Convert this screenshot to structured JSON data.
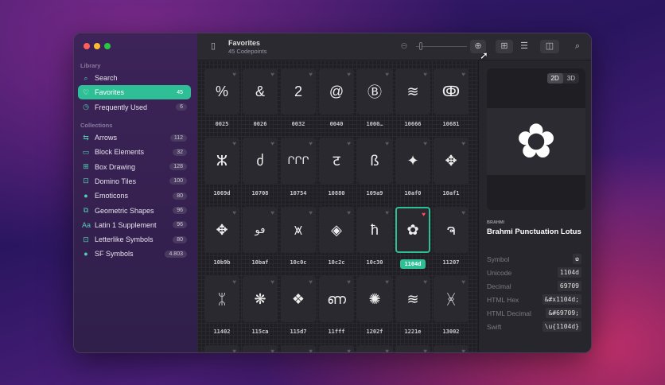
{
  "sidebar": {
    "library_label": "Library",
    "collections_label": "Collections",
    "library": [
      {
        "label": "Search",
        "icon": "search-icon",
        "glyph": "⌕",
        "count": null
      },
      {
        "label": "Favorites",
        "icon": "heart-icon",
        "glyph": "♡",
        "count": "45",
        "active": true
      },
      {
        "label": "Frequently Used",
        "icon": "clock-icon",
        "glyph": "◷",
        "count": "6"
      }
    ],
    "collections": [
      {
        "label": "Arrows",
        "icon": "arrows-icon",
        "glyph": "⇆",
        "count": "112"
      },
      {
        "label": "Block Elements",
        "icon": "block-elements-icon",
        "glyph": "▭",
        "count": "32"
      },
      {
        "label": "Box Drawing",
        "icon": "box-drawing-icon",
        "glyph": "⊞",
        "count": "128"
      },
      {
        "label": "Domino Tiles",
        "icon": "gamepad-icon",
        "glyph": "⊡",
        "count": "100"
      },
      {
        "label": "Emoticons",
        "icon": "emoticon-icon",
        "glyph": "●",
        "count": "80"
      },
      {
        "label": "Geometric Shapes",
        "icon": "shapes-icon",
        "glyph": "⧉",
        "count": "96"
      },
      {
        "label": "Latin 1 Supplement",
        "icon": "text-aa-icon",
        "glyph": "Aa",
        "count": "96"
      },
      {
        "label": "Letterlike Symbols",
        "icon": "letterlike-icon",
        "glyph": "⊡",
        "count": "80"
      },
      {
        "label": "SF Symbols",
        "icon": "apple-icon",
        "glyph": "●",
        "count": "4.803"
      }
    ]
  },
  "toolbar": {
    "title": "Favorites",
    "subtitle": "45 Codepoints"
  },
  "grid": {
    "selected": "1104d",
    "tiles": [
      {
        "glyph": "%",
        "code": "0025"
      },
      {
        "glyph": "&",
        "code": "0026"
      },
      {
        "glyph": "2",
        "code": "0032"
      },
      {
        "glyph": "@",
        "code": "0040"
      },
      {
        "glyph": "Ⓑ",
        "code": "1000…"
      },
      {
        "glyph": "≋",
        "code": "10666"
      },
      {
        "glyph": "ↂ",
        "code": "10681"
      },
      {
        "glyph": "ⵣ",
        "code": "1069d"
      },
      {
        "glyph": "ძ",
        "code": "10708"
      },
      {
        "glyph": "ՐՐՐ",
        "code": "10754"
      },
      {
        "glyph": "ट",
        "code": "10880"
      },
      {
        "glyph": "ß",
        "code": "109a9"
      },
      {
        "glyph": "✦",
        "code": "10af0"
      },
      {
        "glyph": "✥",
        "code": "10af1"
      },
      {
        "glyph": "✥",
        "code": "10b9b"
      },
      {
        "glyph": "ڡو",
        "code": "10baf"
      },
      {
        "glyph": "⩙",
        "code": "10c0c"
      },
      {
        "glyph": "◈",
        "code": "10c2c"
      },
      {
        "glyph": "ħ",
        "code": "10c30"
      },
      {
        "glyph": "✿",
        "code": "1104d"
      },
      {
        "glyph": "ຈ",
        "code": "11207"
      },
      {
        "glyph": "ᛯ",
        "code": "11402"
      },
      {
        "glyph": "❋",
        "code": "115ca"
      },
      {
        "glyph": "❖",
        "code": "115d7"
      },
      {
        "glyph": "ണ",
        "code": "11fff"
      },
      {
        "glyph": "✺",
        "code": "1202f"
      },
      {
        "glyph": "≋",
        "code": "1221e"
      },
      {
        "glyph": "ᚸ",
        "code": "13002"
      },
      {
        "glyph": "",
        "code": ""
      },
      {
        "glyph": "",
        "code": ""
      },
      {
        "glyph": "",
        "code": ""
      },
      {
        "glyph": "",
        "code": ""
      },
      {
        "glyph": "",
        "code": ""
      },
      {
        "glyph": "",
        "code": ""
      },
      {
        "glyph": "",
        "code": ""
      }
    ]
  },
  "detail": {
    "mode_2d": "2D",
    "mode_3d": "3D",
    "glyph": "✿",
    "block": "BRAHMI",
    "name": "Brahmi Punctuation Lotus",
    "props": [
      {
        "key": "Symbol",
        "value": "✿"
      },
      {
        "key": "Unicode",
        "value": "1104d"
      },
      {
        "key": "Decimal",
        "value": "69709"
      },
      {
        "key": "HTML Hex",
        "value": "&#x1104d;"
      },
      {
        "key": "HTML Decimal",
        "value": "&#69709;"
      },
      {
        "key": "Swift",
        "value": "\\u{1104d}"
      }
    ]
  }
}
